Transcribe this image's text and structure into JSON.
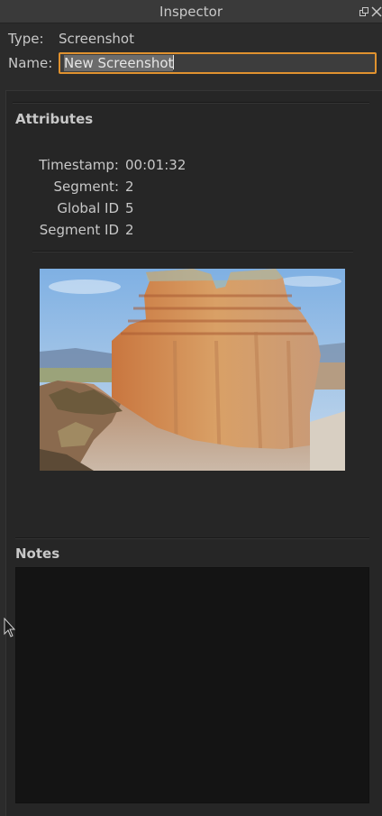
{
  "window": {
    "title": "Inspector"
  },
  "header": {
    "type_label": "Type:",
    "type_value": "Screenshot",
    "name_label": "Name:",
    "name_value": "New Screenshot"
  },
  "attributes": {
    "title": "Attributes",
    "rows": [
      {
        "label": "Timestamp:",
        "value": "00:01:32"
      },
      {
        "label": "Segment:",
        "value": "2"
      },
      {
        "label": "Global ID",
        "value": "5"
      },
      {
        "label": "Segment ID",
        "value": "2"
      }
    ]
  },
  "notes": {
    "title": "Notes",
    "value": ""
  },
  "colors": {
    "accent": "#e0922f",
    "background": "#2b2b2b",
    "notes_background": "#141414"
  },
  "icons": {
    "float": "float-window-icon",
    "close": "close-icon"
  }
}
